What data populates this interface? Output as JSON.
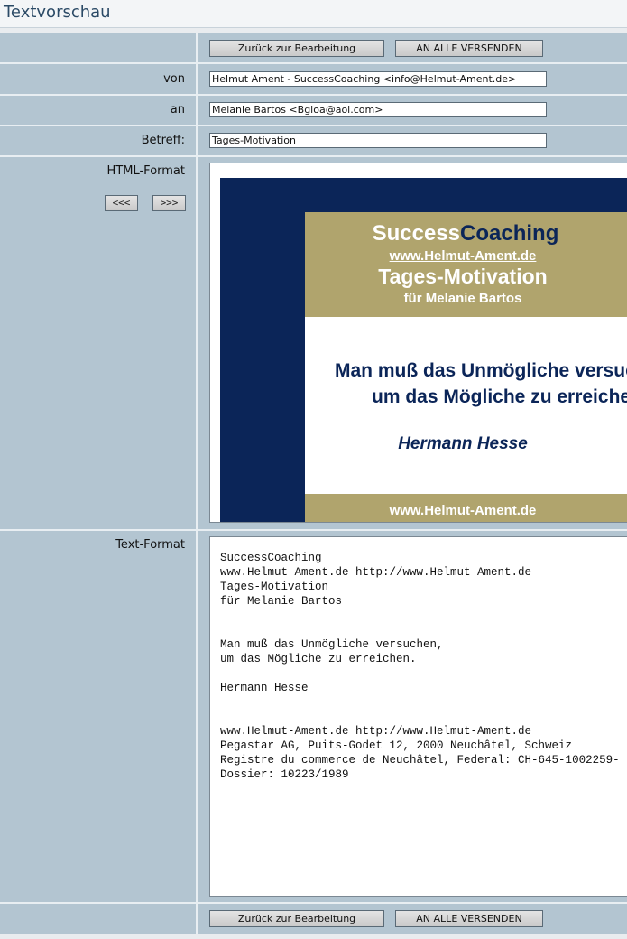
{
  "page": {
    "title": "Textvorschau"
  },
  "buttons": {
    "back": "Zurück zur Bearbeitung",
    "send_all": "AN ALLE VERSENDEN",
    "prev": "<<<",
    "next": ">>>"
  },
  "fields": {
    "from_label": "von",
    "from_value": "Helmut Ament - SuccessCoaching <info@Helmut-Ament.de>",
    "to_label": "an",
    "to_value": "Melanie Bartos <Bgloa@aol.com>",
    "subject_label": "Betreff:",
    "subject_value": "Tages-Motivation"
  },
  "html_preview": {
    "label": "HTML-Format",
    "brand_part1": "Success",
    "brand_part2": "Coaching",
    "site": "www.Helmut-Ament.de",
    "headline": "Tages-Motivation",
    "recipient": "für Melanie Bartos",
    "quote_line1": "Man muß das Unmögliche versuchen,",
    "quote_line2": "um das Mögliche zu erreichen.",
    "author": "Hermann Hesse",
    "footer_site": "www.Helmut-Ament.de",
    "colors": {
      "navy": "#0b2558",
      "gold": "#b0a46d"
    }
  },
  "text_preview": {
    "label": "Text-Format",
    "lines": [
      "SuccessCoaching",
      "www.Helmut-Ament.de http://www.Helmut-Ament.de",
      "Tages-Motivation",
      "für Melanie Bartos",
      "",
      "",
      "Man muß das Unmögliche versuchen,",
      "um das Mögliche zu erreichen.",
      "",
      "Hermann Hesse",
      "",
      "",
      "www.Helmut-Ament.de http://www.Helmut-Ament.de",
      "Pegastar AG, Puits-Godet 12, 2000 Neuchâtel, Schweiz",
      "Registre du commerce de Neuchâtel, Federal: CH-645-1002259-",
      "Dossier: 10223/1989"
    ]
  }
}
